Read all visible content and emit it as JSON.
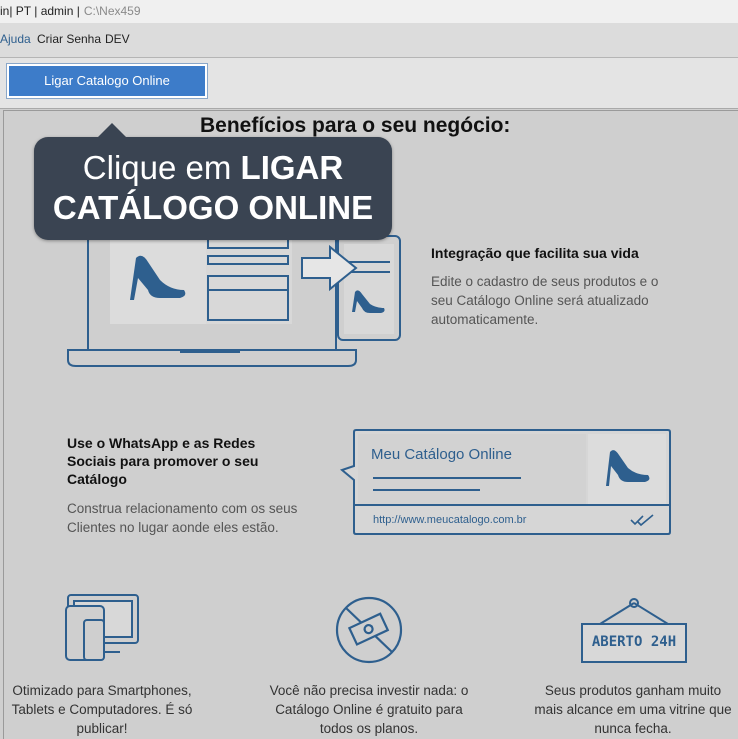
{
  "titlebar": {
    "text": "in| PT | admin |",
    "path": "C:\\Nex459"
  },
  "menu": {
    "ajuda": "Ajuda",
    "criar_senha": "Criar Senha",
    "dev": "DEV"
  },
  "toolbar": {
    "ligar_button": "Ligar Catalogo Online"
  },
  "main": {
    "heading": "Benefícios para o seu negócio:"
  },
  "tooltip": {
    "line1": "Clique em",
    "line1_bold": "LIGAR",
    "line2": "CATÁLOGO ONLINE"
  },
  "features": {
    "integracao": {
      "title": "Integração que facilita sua vida",
      "desc_lines": [
        "Edite o cadastro de seus produtos e o",
        "seu Catálogo Online será atualizado",
        "automaticamente."
      ]
    },
    "whatsapp": {
      "title_lines": [
        "Use o WhatsApp e as Redes",
        "Sociais para promover o seu",
        "Catálogo"
      ],
      "desc_lines": [
        "Construa relacionamento com os seus",
        "Clientes no lugar aonde eles estão."
      ]
    }
  },
  "card": {
    "title": "Meu Catálogo Online",
    "url": "http://www.meucatalogo.com.br"
  },
  "sign": {
    "text": "ABERTO 24H"
  },
  "bottom": {
    "col1": [
      "Otimizado para Smartphones,",
      "Tablets e Computadores. É só",
      "publicar!"
    ],
    "col2": [
      "Você não precisa investir nada: o",
      "Catálogo Online é gratuito para",
      "todos os planos."
    ],
    "col3": [
      "Seus produtos ganham muito",
      "mais alcance em uma vitrine que",
      "nunca fecha."
    ]
  },
  "colors": {
    "accent": "#3d7cc9",
    "illustration": "#2e5f8e",
    "tooltip_bg": "#3a4452",
    "background": "#cfcfcf"
  },
  "icons": [
    "shoe-icon",
    "arrow-right-icon",
    "devices-icon",
    "no-money-icon",
    "open-sign-icon",
    "double-check-icon"
  ]
}
